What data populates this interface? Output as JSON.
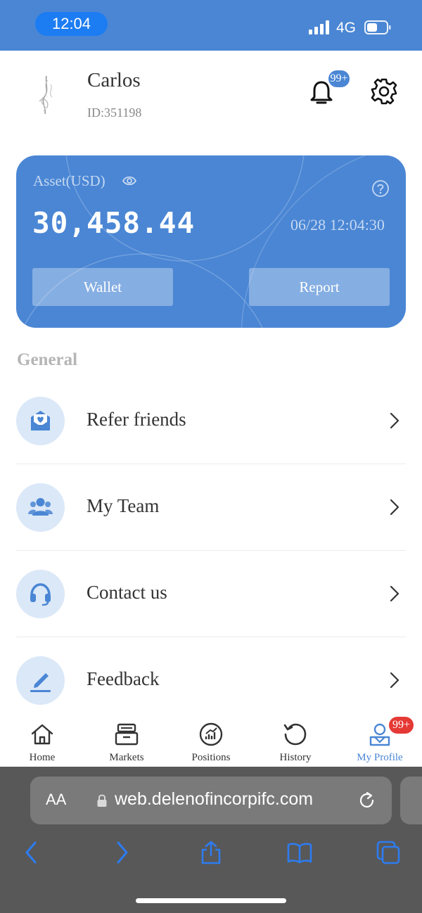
{
  "status_bar": {
    "time": "12:04",
    "network": "4G"
  },
  "profile": {
    "name": "Carlos",
    "id": "ID:351198",
    "notification_badge": "99+"
  },
  "asset_card": {
    "label": "Asset(USD)",
    "value": "30,458.44",
    "timestamp": "06/28 12:04:30",
    "wallet_button": "Wallet",
    "report_button": "Report"
  },
  "general": {
    "title": "General",
    "items": [
      {
        "label": "Refer friends",
        "icon": "refer-icon"
      },
      {
        "label": "My Team",
        "icon": "team-icon"
      },
      {
        "label": "Contact us",
        "icon": "headset-icon"
      },
      {
        "label": "Feedback",
        "icon": "edit-icon"
      }
    ]
  },
  "tabbar": {
    "tabs": [
      {
        "label": "Home",
        "icon": "home-icon"
      },
      {
        "label": "Markets",
        "icon": "markets-icon"
      },
      {
        "label": "Positions",
        "icon": "positions-icon"
      },
      {
        "label": "History",
        "icon": "history-icon"
      },
      {
        "label": "My Profile",
        "icon": "profile-icon",
        "active": true
      }
    ],
    "profile_badge": "99+"
  },
  "browser": {
    "aa_label": "AA",
    "url": "web.delenofincorpifc.com"
  },
  "colors": {
    "accent": "#4a86d4",
    "icon_bg": "#dbe8f8",
    "badge_red": "#e53935"
  }
}
